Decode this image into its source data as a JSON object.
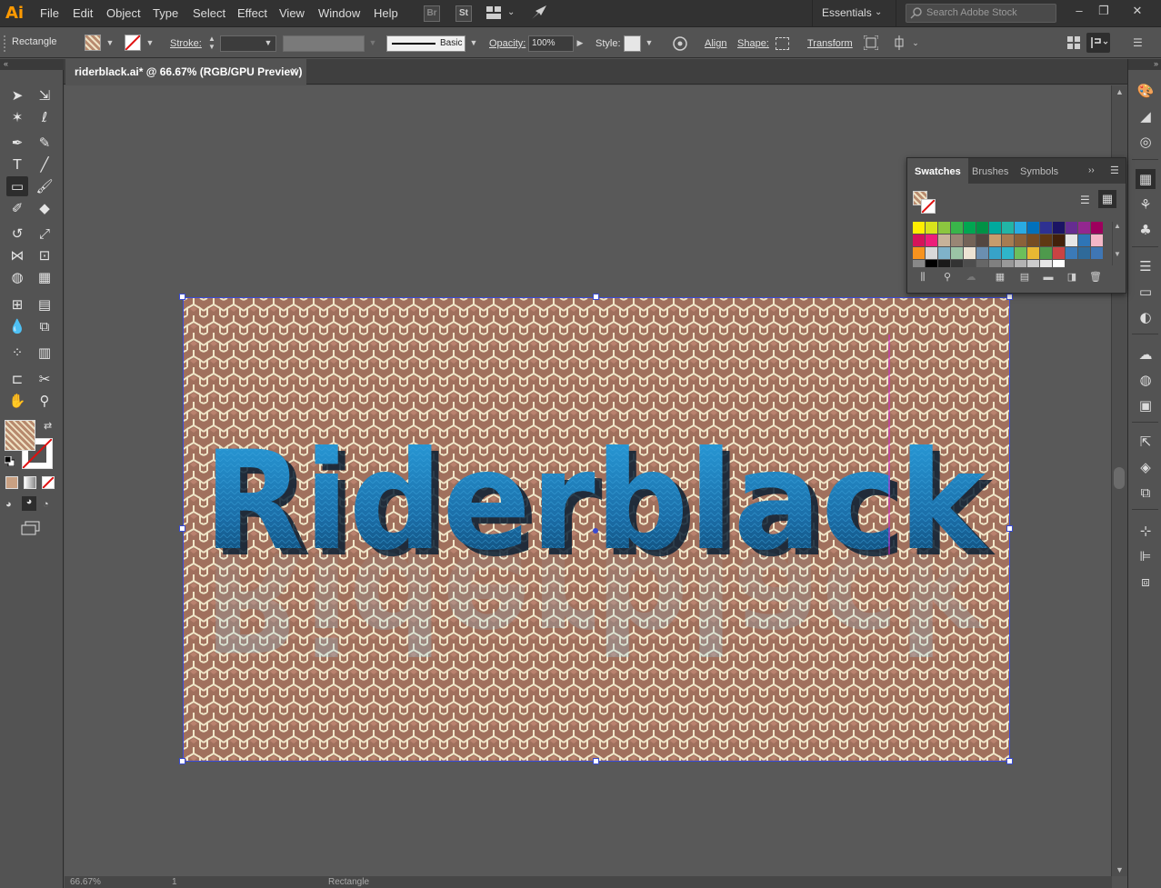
{
  "app": {
    "logo": "Ai"
  },
  "menu": [
    "File",
    "Edit",
    "Object",
    "Type",
    "Select",
    "Effect",
    "View",
    "Window",
    "Help"
  ],
  "bridge_buttons": [
    "Br",
    "St"
  ],
  "workspace": "Essentials",
  "search": {
    "placeholder": "Search Adobe Stock"
  },
  "control": {
    "tool_name": "Rectangle",
    "stroke_label": "Stroke:",
    "brush_label": "Basic",
    "opacity_label": "Opacity:",
    "opacity_value": "100%",
    "style_label": "Style:",
    "align_label": "Align",
    "shape_label": "Shape:",
    "transform_label": "Transform"
  },
  "document": {
    "tab_title": "riderblack.ai* @ 66.67% (RGB/GPU Preview)",
    "close": "×",
    "artwork_text": "Riderblack"
  },
  "status": {
    "zoom": "66.67%",
    "artboard": "1",
    "tool": "Rectangle"
  },
  "swatches_panel": {
    "tabs": [
      "Swatches",
      "Brushes",
      "Symbols"
    ],
    "row1": [
      "#ffee00",
      "#d8e31c",
      "#8cc63f",
      "#39b54a",
      "#00a651",
      "#009245",
      "#00a99d",
      "#22b5a6",
      "#29abe2",
      "#0071bc",
      "#2e3192",
      "#1b1464",
      "#662d91",
      "#93278f",
      "#9e005d"
    ],
    "row2": [
      "#d4145a",
      "#ed1e79",
      "#c7b299",
      "#998675",
      "#736357",
      "#534741",
      "#c69c6d",
      "#a67c52",
      "#8c6239",
      "#754c24",
      "#603813",
      "#42210b",
      "#e6e6e6",
      "#2e75b6",
      "#f4b7c7"
    ],
    "row3": [
      "#f7931e",
      "#d9d9d9",
      "#7fb2c9",
      "#9bc4a6",
      "#ece3d3",
      "#6b8fb0",
      "#37a3c8",
      "#2fb5c9",
      "#6cbf5b",
      "#e8b833",
      "#4e9a4c",
      "#c94343",
      "#3b7ab8",
      "#2f6a99",
      "#3f76b4"
    ],
    "row4": [
      "#888888",
      "#000000",
      "#1a1a1a",
      "#333333",
      "#4d4d4d",
      "#666666",
      "#808080",
      "#999999",
      "#b3b3b3",
      "#cccccc",
      "#e6e6e6",
      "#ffffff"
    ]
  },
  "colors": {
    "accent": "#3b4bd8",
    "text_gradient_top": "#2aa2e0",
    "text_gradient_bottom": "#0b3e63",
    "pattern_bg": "#a0705d",
    "pattern_line": "#f0e6c8"
  }
}
